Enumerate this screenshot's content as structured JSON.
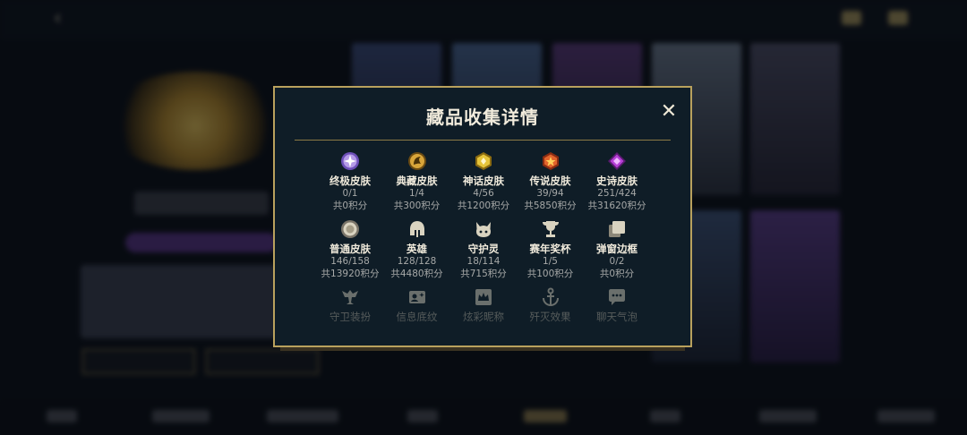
{
  "modal": {
    "title": "藏品收集详情",
    "close_symbol": "✕",
    "rows": [
      [
        {
          "icon": "ultimate-skin-icon",
          "name": "终极皮肤",
          "count": "0/1",
          "score": "共0积分",
          "color": "#b59ae8"
        },
        {
          "icon": "collection-skin-icon",
          "name": "典藏皮肤",
          "count": "1/4",
          "score": "共300积分",
          "color": "#d8a53a"
        },
        {
          "icon": "mythic-skin-icon",
          "name": "神话皮肤",
          "count": "4/56",
          "score": "共1200积分",
          "color": "#e6c43a"
        },
        {
          "icon": "legendary-skin-icon",
          "name": "传说皮肤",
          "count": "39/94",
          "score": "共5850积分",
          "color": "#e2642c"
        },
        {
          "icon": "epic-skin-icon",
          "name": "史诗皮肤",
          "count": "251/424",
          "score": "共31620积分",
          "color": "#b63fd6"
        }
      ],
      [
        {
          "icon": "normal-skin-icon",
          "name": "普通皮肤",
          "count": "146/158",
          "score": "共13920积分",
          "color": "#d9d3c0"
        },
        {
          "icon": "hero-helmet-icon",
          "name": "英雄",
          "count": "128/128",
          "score": "共4480积分",
          "color": "#d9d3c0"
        },
        {
          "icon": "spirit-icon",
          "name": "守护灵",
          "count": "18/114",
          "score": "共715积分",
          "color": "#d9d3c0"
        },
        {
          "icon": "trophy-icon",
          "name": "赛年奖杯",
          "count": "1/5",
          "score": "共100积分",
          "color": "#d9d3c0"
        },
        {
          "icon": "frame-icon",
          "name": "弹窗边框",
          "count": "0/2",
          "score": "共0积分",
          "color": "#d9d3c0"
        }
      ],
      [
        {
          "icon": "guard-outfit-icon",
          "name": "守卫装扮"
        },
        {
          "icon": "info-card-icon",
          "name": "信息底纹"
        },
        {
          "icon": "crown-icon",
          "name": "炫彩昵称"
        },
        {
          "icon": "anchor-icon",
          "name": "歼灭效果"
        },
        {
          "icon": "chat-bubble-icon",
          "name": "聊天气泡"
        }
      ]
    ]
  },
  "colors": {
    "accent": "#b9a15d",
    "panel": "#0f1d27",
    "text": "#f1ebdc",
    "muted": "#a7a9a8"
  }
}
